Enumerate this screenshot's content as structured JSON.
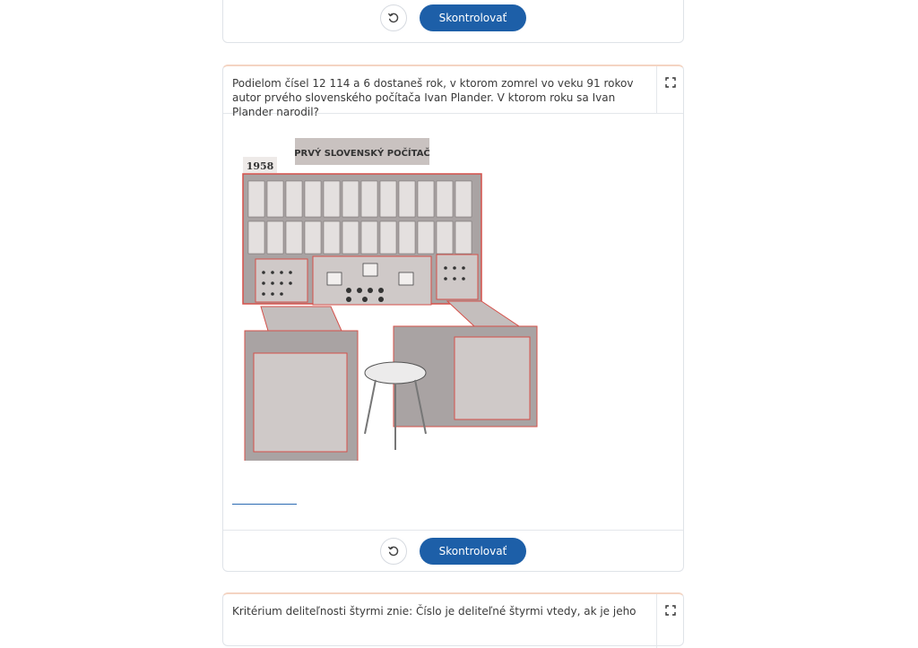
{
  "buttons": {
    "check_label": "Skontrolovať"
  },
  "question_2": {
    "text": "Podielom čísel 12 114 a 6 dostaneš rok, v ktorom zomrel vo veku 91 rokov autor prvého slovenského počítača Ivan Plander. V ktorom roku sa Ivan Plander narodil?",
    "image": {
      "sign_label": "PRVÝ SLOVENSKÝ POČÍTAČ",
      "year_label": "1958"
    },
    "answer_value": ""
  },
  "question_3": {
    "text": "Kritérium deliteľnosti štyrmi znie: Číslo je deliteľné štyrmi vtedy, ak je jeho"
  },
  "icons": {
    "reset": "reset-icon",
    "expand": "expand-icon"
  },
  "colors": {
    "primary_button": "#1d5fa8",
    "card_accent": "#f4d4c2",
    "computer_body": "#a9a3a3",
    "computer_outline": "#d5504a"
  }
}
